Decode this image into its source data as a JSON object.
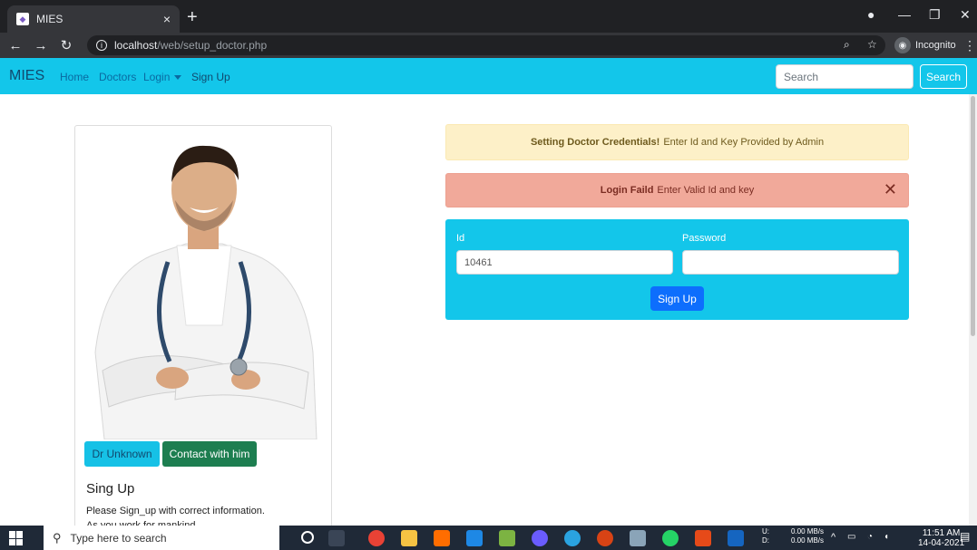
{
  "browser": {
    "tab_title": "MIES",
    "tab_close": "×",
    "new_tab": "+",
    "url_host": "localhost",
    "url_path": "/web/setup_doctor.php",
    "mode_label": "Incognito"
  },
  "navbar": {
    "brand": "MIES",
    "links": [
      "Home",
      "Doctors",
      "Login",
      "Sign Up"
    ],
    "search_placeholder": "Search",
    "search_button": "Search"
  },
  "doctor_card": {
    "btn_name": "Dr Unknown",
    "btn_contact": "Contact with him",
    "title": "Sing Up",
    "text_line1": "Please Sign_up with correct information.",
    "text_line2": "As you work for mankind ."
  },
  "alerts": {
    "warning_bold": "Setting Doctor Credentials!",
    "warning_text": "Enter Id and Key Provided by Admin",
    "danger_bold": "Login Faild",
    "danger_text": "Enter Valid Id and key",
    "danger_close": "✕"
  },
  "form": {
    "id_label": "Id",
    "id_value": "10461",
    "password_label": "Password",
    "password_value": "",
    "submit_label": "Sign Up"
  },
  "taskbar": {
    "search_placeholder": "Type here to search",
    "net_up": "0.00 MB/s",
    "net_down": "0.00 MB/s",
    "net_up_label": "U:",
    "net_down_label": "D:",
    "time": "11:51 AM",
    "date": "14-04-2021"
  },
  "colors": {
    "navbar_bg": "#13c6ea",
    "warning_bg": "#fdf0c8",
    "danger_bg": "#f1a99a",
    "primary_btn": "#0d6efd",
    "success_btn": "#1d7e50"
  }
}
